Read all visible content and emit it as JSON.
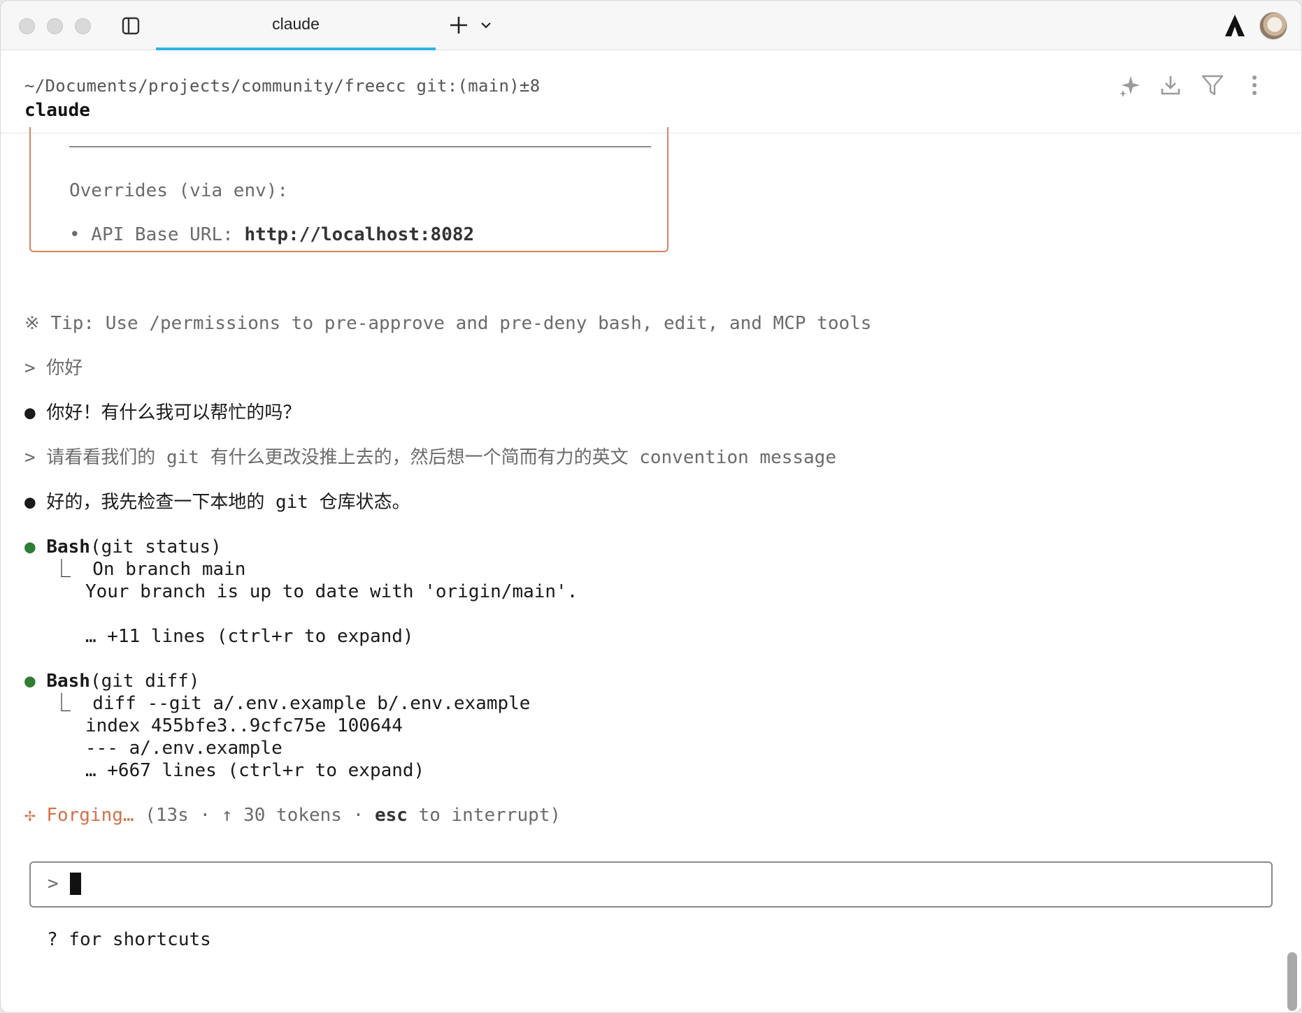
{
  "tab": {
    "title": "claude"
  },
  "header": {
    "path": "~/Documents/projects/community/freecc git:(main)±8",
    "session": "claude"
  },
  "config": {
    "overrides_heading": "Overrides (via env):",
    "api_label": "• API Base URL: ",
    "api_value": "http://localhost:8082"
  },
  "tip": "※ Tip: Use /permissions to pre-approve and pre-deny bash, edit, and MCP tools",
  "conversation": [
    {
      "role": "user",
      "text": "> 你好"
    },
    {
      "role": "assistant",
      "bullet": "●",
      "text": "你好！有什么我可以帮忙的吗？"
    },
    {
      "role": "user",
      "text": "> 请看看我们的 git 有什么更改没推上去的，然后想一个简而有力的英文 convention message"
    },
    {
      "role": "assistant",
      "bullet": "●",
      "text": "好的，我先检查一下本地的 git 仓库状态。"
    }
  ],
  "tool_calls": [
    {
      "bullet": "●",
      "tool": "Bash",
      "args": "(git status)",
      "output": [
        "⎿  On branch main",
        "   Your branch is up to date with 'origin/main'.",
        "",
        "   … +11 lines (ctrl+r to expand)"
      ]
    },
    {
      "bullet": "●",
      "tool": "Bash",
      "args": "(git diff)",
      "output": [
        "⎿  diff --git a/.env.example b/.env.example",
        "   index 455bfe3..9cfc75e 100644",
        "   --- a/.env.example",
        "   … +667 lines (ctrl+r to expand)"
      ]
    }
  ],
  "status": {
    "spinner": "✢",
    "verb": "Forging…",
    "detail_start": "(13s · ↑ 30 tokens · ",
    "key": "esc",
    "detail_end": " to interrupt)"
  },
  "input": {
    "prompt": ">",
    "value": ""
  },
  "hint": "? for shortcuts",
  "colors": {
    "accent_tab": "#2eb3e6",
    "orange": "#d4704a",
    "tool_dot": "#2e7d32",
    "box_border": "#d98360"
  }
}
